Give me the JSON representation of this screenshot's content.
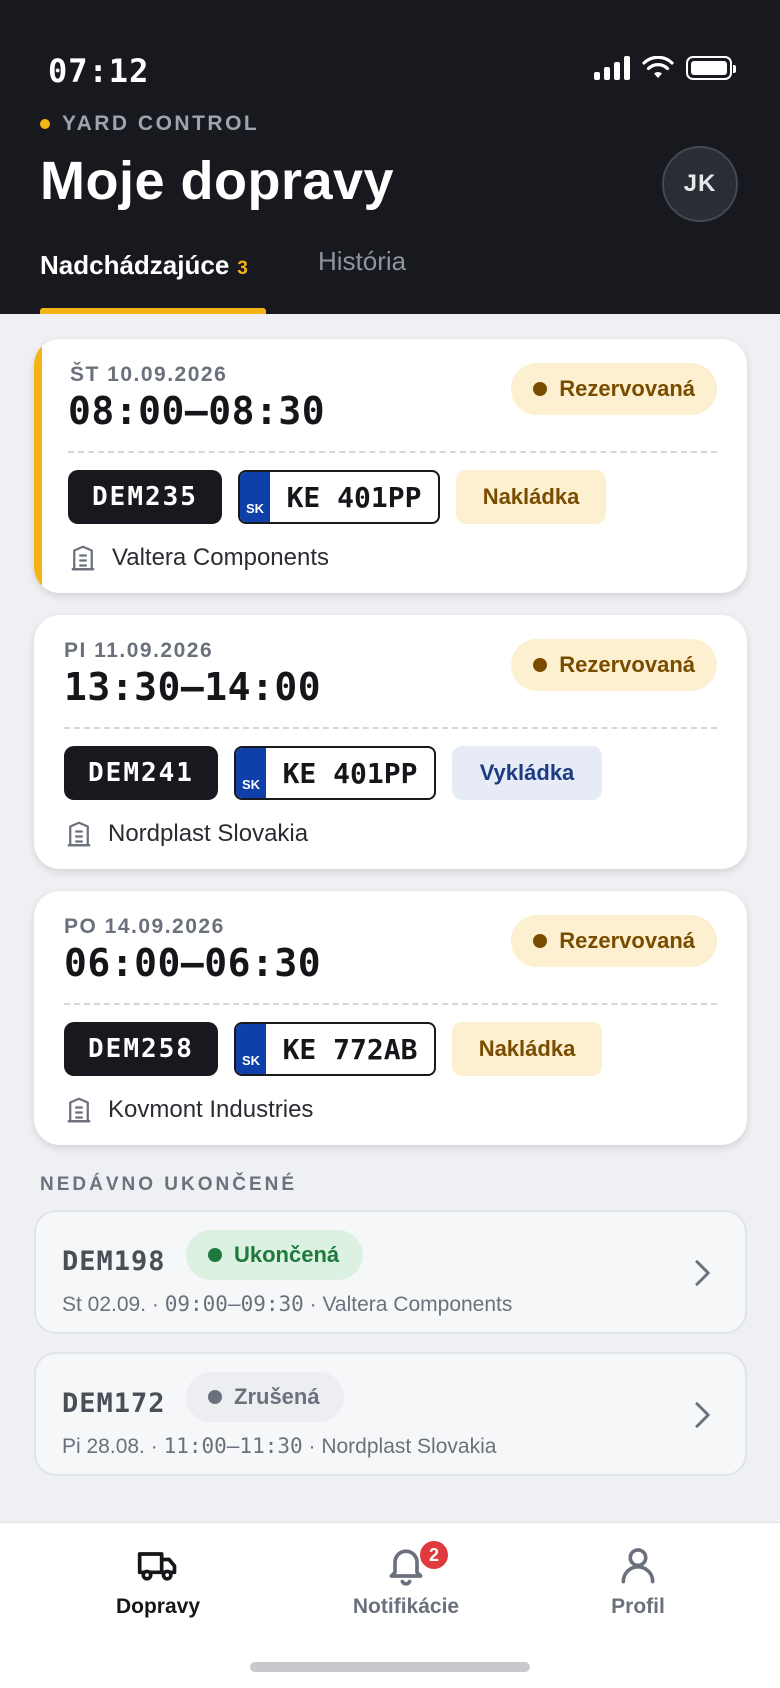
{
  "status_bar": {
    "time": "07:12"
  },
  "header": {
    "brand": "YARD CONTROL",
    "title": "Moje dopravy",
    "avatar_initials": "JK",
    "tabs": [
      {
        "label": "Nadchádzajúce",
        "count": "3"
      },
      {
        "label": "História"
      }
    ]
  },
  "colors": {
    "accent": "#f4b416",
    "dark": "#17191e",
    "plate_blue": "#0f3fa8",
    "done": "#1d7a3c",
    "badge": "#e03a3e"
  },
  "upcoming": [
    {
      "date": "ŠT 10.09.2026",
      "time": "08:00–08:30",
      "status": "Rezervovaná",
      "dem": "DEM235",
      "country": "SK",
      "plate": "KE 401PP",
      "type": "Nakládka",
      "company": "Valtera Components"
    },
    {
      "date": "PI 11.09.2026",
      "time": "13:30–14:00",
      "status": "Rezervovaná",
      "dem": "DEM241",
      "country": "SK",
      "plate": "KE 401PP",
      "type": "Vykládka",
      "company": "Nordplast Slovakia"
    },
    {
      "date": "PO 14.09.2026",
      "time": "06:00–06:30",
      "status": "Rezervovaná",
      "dem": "DEM258",
      "country": "SK",
      "plate": "KE 772AB",
      "type": "Nakládka",
      "company": "Kovmont Industries"
    }
  ],
  "recent_label": "NEDÁVNO UKONČENÉ",
  "recent": [
    {
      "dem": "DEM198",
      "status": "Ukončená",
      "day": "St 02.09. ·",
      "time": "09:00–09:30",
      "company": "· Valtera Components"
    },
    {
      "dem": "DEM172",
      "status": "Zrušená",
      "day": "Pi 28.08. ·",
      "time": "11:00–11:30",
      "company": "· Nordplast Slovakia"
    }
  ],
  "nav": {
    "dopravy": "Dopravy",
    "notifikacie": "Notifikácie",
    "notif_badge": "2",
    "profil": "Profil"
  }
}
